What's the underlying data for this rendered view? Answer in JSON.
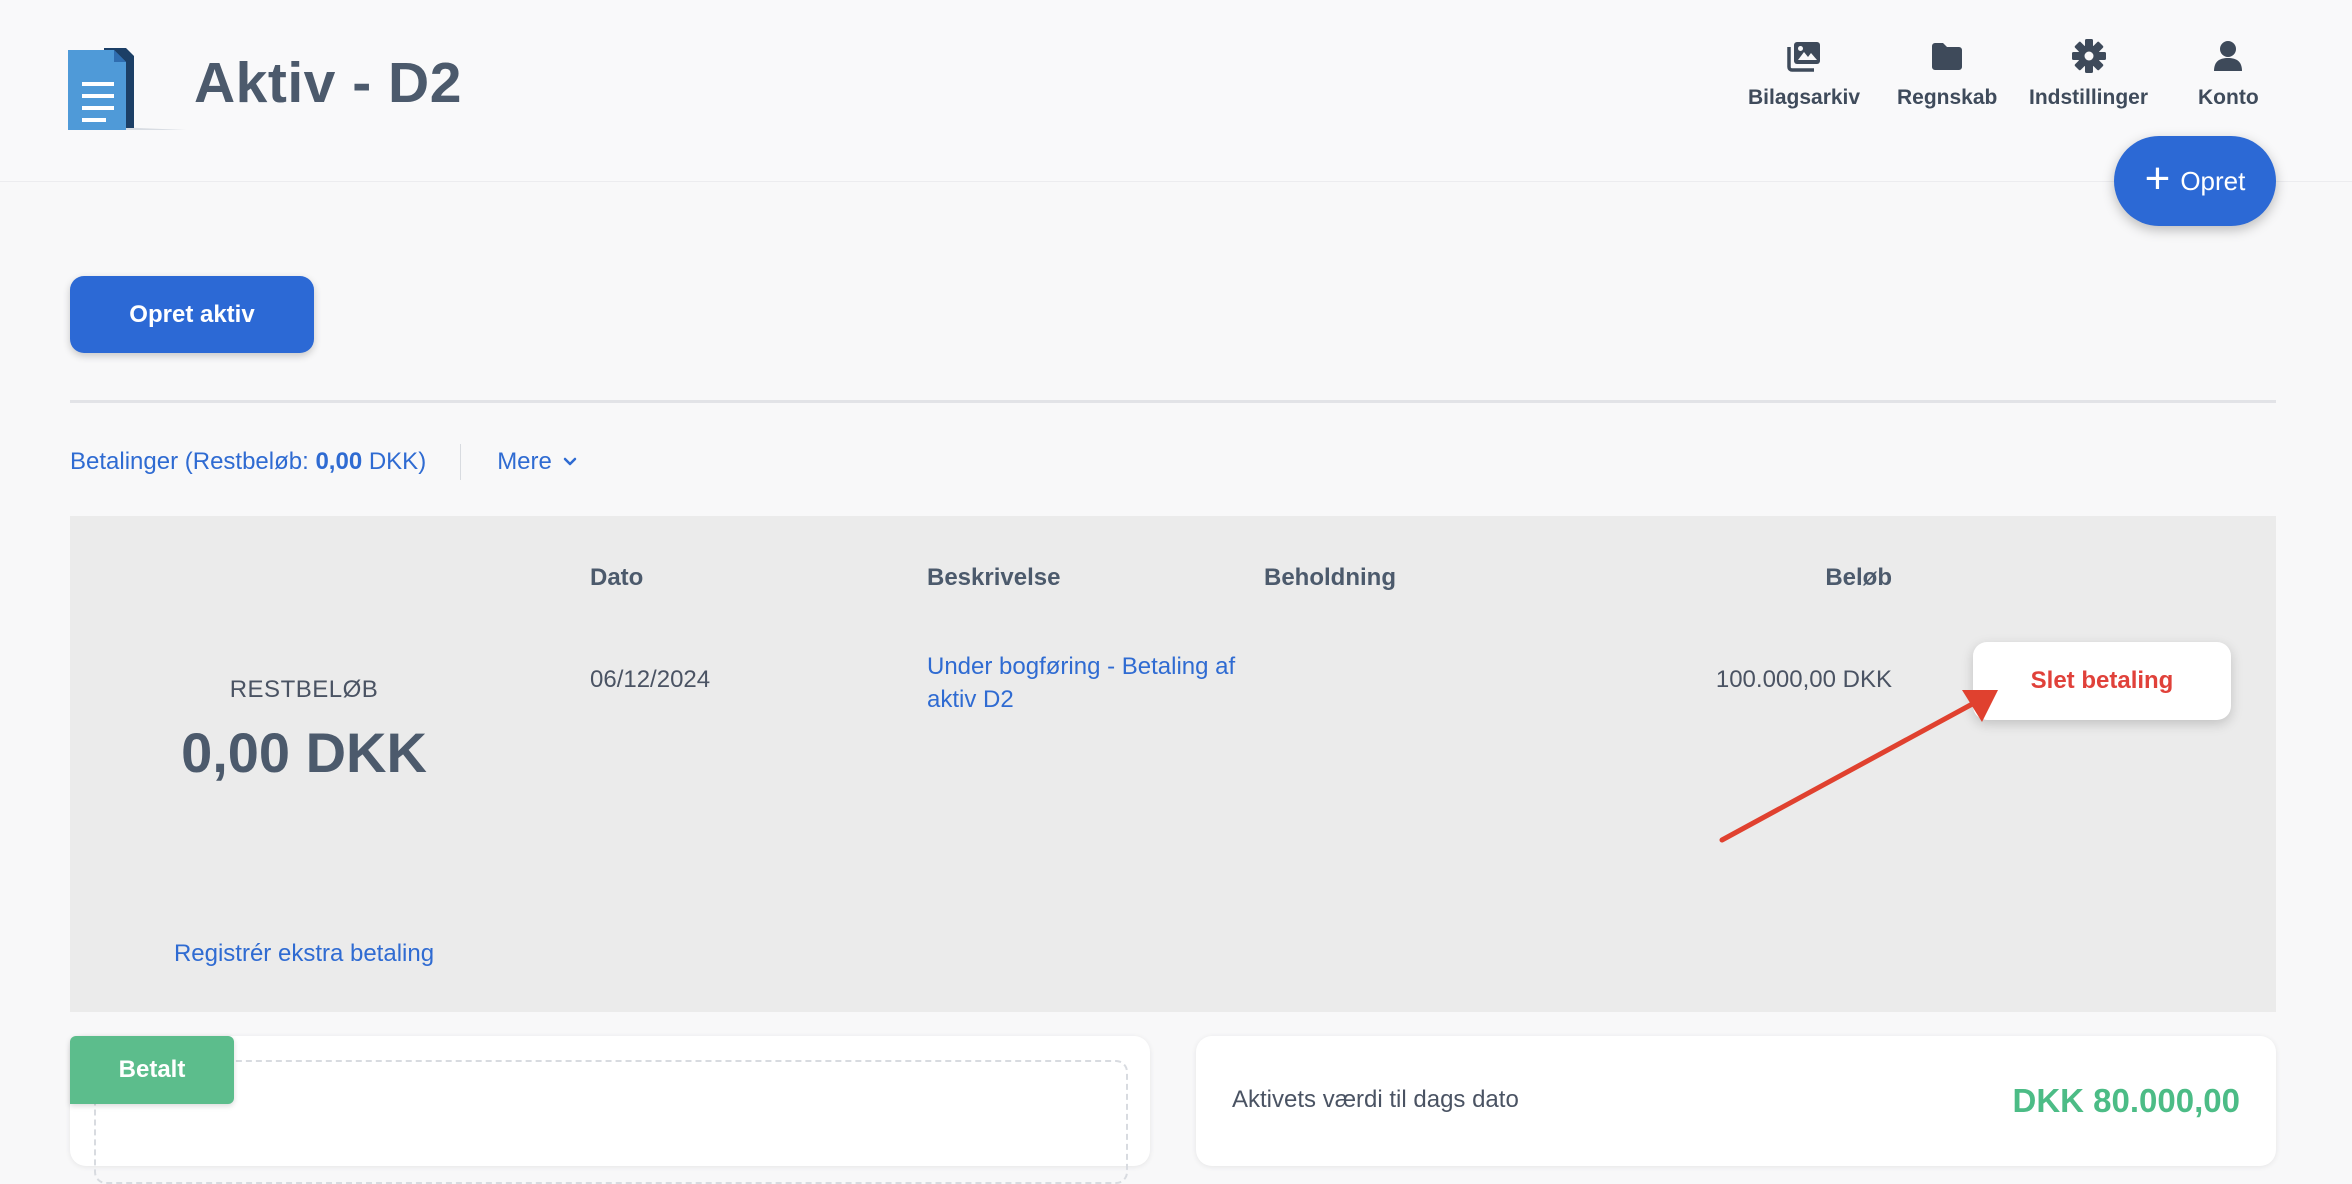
{
  "header": {
    "title": "Aktiv - D2",
    "nav": [
      {
        "label": "Bilagsarkiv",
        "icon": "photo-album-icon"
      },
      {
        "label": "Regnskab",
        "icon": "folder-icon"
      },
      {
        "label": "Indstillinger",
        "icon": "gear-icon"
      },
      {
        "label": "Konto",
        "icon": "user-icon"
      }
    ],
    "create_label": "Opret"
  },
  "actions": {
    "create_asset_label": "Opret aktiv"
  },
  "tabs": {
    "payments_prefix": "Betalinger (Restbeløb: ",
    "payments_amount": "0,00",
    "payments_suffix": " DKK)",
    "more_label": "Mere"
  },
  "payments": {
    "rest_label": "RESTBELØB",
    "rest_amount": "0,00 DKK",
    "register_extra_label": "Registrér ekstra betaling",
    "columns": [
      "Dato",
      "Beskrivelse",
      "Beholdning",
      "Beløb"
    ],
    "rows": [
      {
        "date": "06/12/2024",
        "description": "Under bogføring - Betaling af aktiv D2",
        "holding": "",
        "amount": "100.000,00 DKK",
        "action_label": "Slet betaling"
      }
    ]
  },
  "status": {
    "paid_badge": "Betalt"
  },
  "asset_value": {
    "label": "Aktivets værdi til dags dato",
    "amount": "DKK 80.000,00"
  },
  "colors": {
    "primary": "#2c69d5",
    "danger": "#e0413a",
    "success": "#4cbc86",
    "badge": "#5cbd8c",
    "annotation_arrow": "#e0412f"
  }
}
